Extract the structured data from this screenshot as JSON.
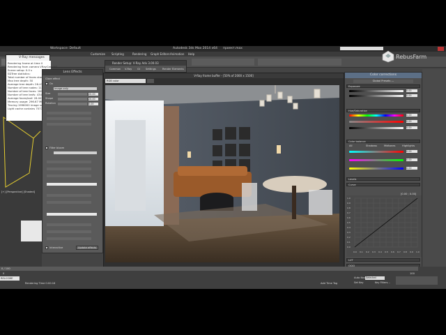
{
  "app": {
    "title": "Autodesk 3ds Max 2014 x64",
    "project_label": "проект.max",
    "workspace": "Workspace: Default",
    "menus": [
      "Customize",
      "Scripting",
      "Rendering",
      "Graph Editors",
      "Animation",
      "Help"
    ],
    "time_field": "0 / 100",
    "status_left": "RELCOME",
    "status_text": "Rendering Time  0:00:16",
    "timeline_start": "0",
    "timeline_end": "100",
    "auto_key": "Auto Key",
    "set_key": "Set Key",
    "selected": "Selected",
    "key_filters": "Key Filters...",
    "add_time_tag": "Add Time Tag"
  },
  "logo": {
    "text": "RebusFarm"
  },
  "vray_messages": {
    "title": "V-Ray messages",
    "lines": [
      "Rendering frame at time 0",
      "Rendering from camera VRayCam001",
      "Scene setup: 0.0 s",
      "SDTree statistics:",
      "Total number of faces stored",
      "Max tree depth: 50",
      "Average tree depth: 26.433",
      "Number of tree nodes: 1150",
      "Number of tree faces: 16060",
      "Number of tree leafs: 434011",
      "Average faces/leaf: 28.0028",
      "Memory usage: 296.67 MB",
      "Tracing 1996000 image samples",
      "Light cache contains 70776 sa"
    ]
  },
  "lens_effects": {
    "title": "Lens Effects",
    "fields": [
      {
        "label": "Size",
        "value": "20.00"
      },
      {
        "label": "Shape",
        "value": "20.00"
      },
      {
        "label": "Rotation",
        "value": "0.00"
      }
    ],
    "glare_label": "Glare effect",
    "on_label": "On",
    "image_only": "Image only",
    "filter_bloom": "Filter bloom",
    "interactive": "Interactive",
    "update_effects": "Update effects"
  },
  "render_setup": {
    "title": "Render Setup: V-Ray Adv 3.00.03",
    "tabs": [
      "Common",
      "V-Ray",
      "GI",
      "Settings",
      "Render Elements"
    ]
  },
  "frame_buffer": {
    "title": "V-Ray frame buffer - [50% of 2000 x 1500]",
    "channel": "RGB color"
  },
  "color_corrections": {
    "title": "Color corrections",
    "global_presets": "Global Presets ---",
    "sections": [
      "Exposure",
      "Hue/Saturation",
      "Color balance",
      "Levels",
      "Curve",
      "LUT",
      "OCIO",
      "ICC"
    ],
    "field_values": [
      "0.00",
      "0.00",
      "0.00",
      "0.00",
      "0.00",
      "0.00",
      "0.00",
      "0.00"
    ],
    "balance_tabs": [
      "All",
      "Shadows",
      "Midtones",
      "Highlights"
    ],
    "curve_readout": "[0.00 ; 0.00]",
    "curve_y_ticks": [
      "1.0",
      "0.9",
      "0.8",
      "0.7",
      "0.6",
      "0.5",
      "0.4",
      "0.3",
      "0.2",
      "0.1",
      "0.0"
    ],
    "curve_x_ticks": [
      "0.0",
      "0.1",
      "0.2",
      "0.3",
      "0.4",
      "0.5",
      "0.6",
      "0.7",
      "0.8",
      "0.9",
      "1.0"
    ]
  },
  "viewport": {
    "label": "[+] [Perspective] [Shaded]"
  }
}
